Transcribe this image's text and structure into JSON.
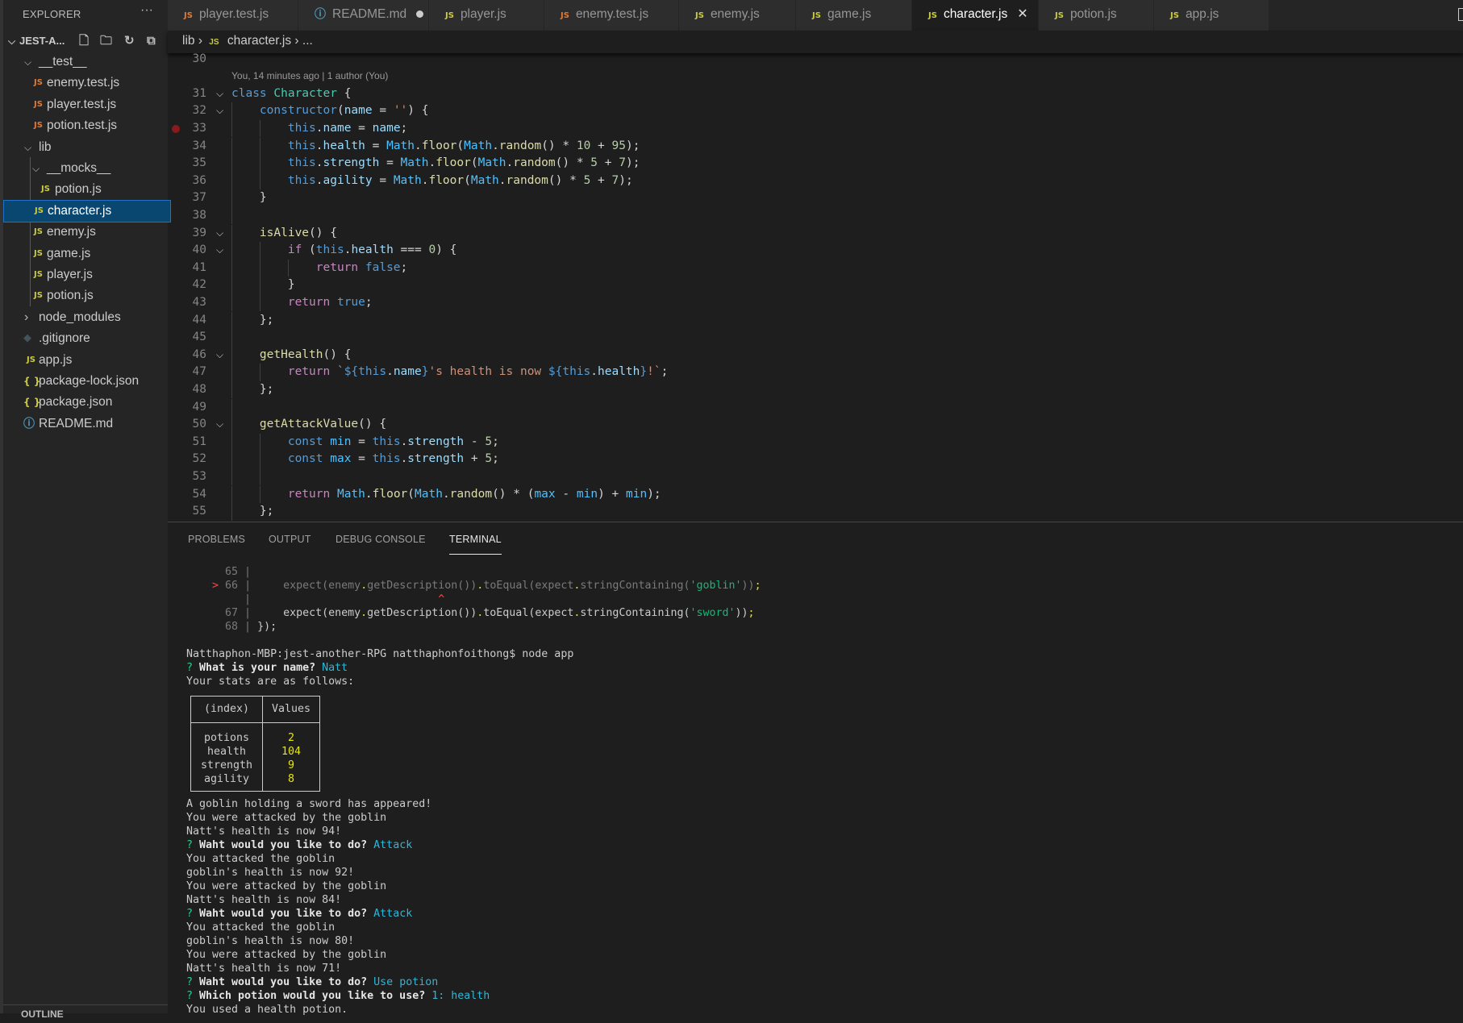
{
  "sidebar": {
    "title": "EXPLORER",
    "more": "···",
    "project": "JEST-A...",
    "outline": "OUTLINE",
    "items": [
      {
        "label": "__test__",
        "type": "folder",
        "open": true
      },
      {
        "label": "enemy.test.js",
        "type": "test"
      },
      {
        "label": "player.test.js",
        "type": "test"
      },
      {
        "label": "potion.test.js",
        "type": "test"
      },
      {
        "label": "lib",
        "type": "folder",
        "open": true
      },
      {
        "label": "__mocks__",
        "type": "folder",
        "open": true
      },
      {
        "label": "potion.js",
        "type": "js"
      },
      {
        "label": "character.js",
        "type": "js",
        "selected": true
      },
      {
        "label": "enemy.js",
        "type": "js"
      },
      {
        "label": "game.js",
        "type": "js"
      },
      {
        "label": "player.js",
        "type": "js"
      },
      {
        "label": "potion.js",
        "type": "js"
      },
      {
        "label": "node_modules",
        "type": "folder",
        "open": false
      },
      {
        "label": ".gitignore",
        "type": "git"
      },
      {
        "label": "app.js",
        "type": "js"
      },
      {
        "label": "package-lock.json",
        "type": "json"
      },
      {
        "label": "package.json",
        "type": "json"
      },
      {
        "label": "README.md",
        "type": "info"
      }
    ]
  },
  "tabs": [
    {
      "label": "player.test.js",
      "icon": "JS",
      "kind": "test"
    },
    {
      "label": "README.md",
      "icon": "ⓘ",
      "kind": "info",
      "dirty": true
    },
    {
      "label": "player.js",
      "icon": "JS",
      "kind": "js"
    },
    {
      "label": "enemy.test.js",
      "icon": "JS",
      "kind": "test"
    },
    {
      "label": "enemy.js",
      "icon": "JS",
      "kind": "js"
    },
    {
      "label": "game.js",
      "icon": "JS",
      "kind": "js"
    },
    {
      "label": "character.js",
      "icon": "JS",
      "kind": "js",
      "active": true
    },
    {
      "label": "potion.js",
      "icon": "JS",
      "kind": "js"
    },
    {
      "label": "app.js",
      "icon": "JS",
      "kind": "js"
    }
  ],
  "breadcrumb": {
    "folder": "lib",
    "icon": "JS",
    "file": "character.js",
    "more": "..."
  },
  "editor": {
    "codelens": "You, 14 minutes ago | 1 author (You)",
    "lines": [
      {
        "n": "30",
        "tokens": []
      },
      {
        "lens": true
      },
      {
        "n": "31",
        "fold": true,
        "tokens": [
          [
            "class",
            "k"
          ],
          [
            " ",
            ""
          ],
          [
            "Character",
            "t"
          ],
          [
            " {",
            ""
          ]
        ]
      },
      {
        "n": "32",
        "fold": true,
        "tokens": [
          [
            "    ",
            ""
          ],
          [
            "constructor",
            "k"
          ],
          [
            "(",
            ""
          ],
          [
            "name",
            "v"
          ],
          [
            " = ",
            ""
          ],
          [
            "''",
            "s"
          ],
          [
            ") {",
            ""
          ]
        ]
      },
      {
        "n": "33",
        "bp": true,
        "tokens": [
          [
            "        ",
            ""
          ],
          [
            "this",
            "k"
          ],
          [
            ".",
            ""
          ],
          [
            "name",
            "v"
          ],
          [
            " = ",
            ""
          ],
          [
            "name",
            "v"
          ],
          [
            ";",
            ""
          ]
        ]
      },
      {
        "n": "34",
        "tokens": [
          [
            "        ",
            ""
          ],
          [
            "this",
            "k"
          ],
          [
            ".",
            ""
          ],
          [
            "health",
            "v"
          ],
          [
            " = ",
            ""
          ],
          [
            "Math",
            "c2"
          ],
          [
            ".",
            ""
          ],
          [
            "floor",
            "f"
          ],
          [
            "(",
            ""
          ],
          [
            "Math",
            "c2"
          ],
          [
            ".",
            ""
          ],
          [
            "random",
            "f"
          ],
          [
            "() * ",
            ""
          ],
          [
            "10",
            "n"
          ],
          [
            " + ",
            ""
          ],
          [
            "95",
            "n"
          ],
          [
            ");",
            ""
          ]
        ]
      },
      {
        "n": "35",
        "tokens": [
          [
            "        ",
            ""
          ],
          [
            "this",
            "k"
          ],
          [
            ".",
            ""
          ],
          [
            "strength",
            "v"
          ],
          [
            " = ",
            ""
          ],
          [
            "Math",
            "c2"
          ],
          [
            ".",
            ""
          ],
          [
            "floor",
            "f"
          ],
          [
            "(",
            ""
          ],
          [
            "Math",
            "c2"
          ],
          [
            ".",
            ""
          ],
          [
            "random",
            "f"
          ],
          [
            "() * ",
            ""
          ],
          [
            "5",
            "n"
          ],
          [
            " + ",
            ""
          ],
          [
            "7",
            "n"
          ],
          [
            ");",
            ""
          ]
        ]
      },
      {
        "n": "36",
        "tokens": [
          [
            "        ",
            ""
          ],
          [
            "this",
            "k"
          ],
          [
            ".",
            ""
          ],
          [
            "agility",
            "v"
          ],
          [
            " = ",
            ""
          ],
          [
            "Math",
            "c2"
          ],
          [
            ".",
            ""
          ],
          [
            "floor",
            "f"
          ],
          [
            "(",
            ""
          ],
          [
            "Math",
            "c2"
          ],
          [
            ".",
            ""
          ],
          [
            "random",
            "f"
          ],
          [
            "() * ",
            ""
          ],
          [
            "5",
            "n"
          ],
          [
            " + ",
            ""
          ],
          [
            "7",
            "n"
          ],
          [
            ");",
            ""
          ]
        ]
      },
      {
        "n": "37",
        "tokens": [
          [
            "    }",
            ""
          ]
        ]
      },
      {
        "n": "38",
        "tokens": []
      },
      {
        "n": "39",
        "fold": true,
        "tokens": [
          [
            "    ",
            ""
          ],
          [
            "isAlive",
            "f"
          ],
          [
            "() {",
            ""
          ]
        ]
      },
      {
        "n": "40",
        "fold": true,
        "tokens": [
          [
            "        ",
            ""
          ],
          [
            "if",
            "c"
          ],
          [
            " (",
            ""
          ],
          [
            "this",
            "k"
          ],
          [
            ".",
            ""
          ],
          [
            "health",
            "v"
          ],
          [
            " === ",
            ""
          ],
          [
            "0",
            "n"
          ],
          [
            ") {",
            ""
          ]
        ]
      },
      {
        "n": "41",
        "tokens": [
          [
            "            ",
            ""
          ],
          [
            "return",
            "c"
          ],
          [
            " ",
            ""
          ],
          [
            "false",
            "k"
          ],
          [
            ";",
            ""
          ]
        ]
      },
      {
        "n": "42",
        "tokens": [
          [
            "        }",
            ""
          ]
        ]
      },
      {
        "n": "43",
        "tokens": [
          [
            "        ",
            ""
          ],
          [
            "return",
            "c"
          ],
          [
            " ",
            ""
          ],
          [
            "true",
            "k"
          ],
          [
            ";",
            ""
          ]
        ]
      },
      {
        "n": "44",
        "tokens": [
          [
            "    };",
            ""
          ]
        ]
      },
      {
        "n": "45",
        "tokens": []
      },
      {
        "n": "46",
        "fold": true,
        "tokens": [
          [
            "    ",
            ""
          ],
          [
            "getHealth",
            "f"
          ],
          [
            "() {",
            ""
          ]
        ]
      },
      {
        "n": "47",
        "tokens": [
          [
            "        ",
            ""
          ],
          [
            "return",
            "c"
          ],
          [
            " ",
            ""
          ],
          [
            "`",
            "s"
          ],
          [
            "${",
            "k"
          ],
          [
            "this",
            "k"
          ],
          [
            ".",
            ""
          ],
          [
            "name",
            "v"
          ],
          [
            "}",
            "k"
          ],
          [
            "'s health is now ",
            "s"
          ],
          [
            "${",
            "k"
          ],
          [
            "this",
            "k"
          ],
          [
            ".",
            ""
          ],
          [
            "health",
            "v"
          ],
          [
            "}",
            "k"
          ],
          [
            "!`",
            "s"
          ],
          [
            ";",
            ""
          ]
        ]
      },
      {
        "n": "48",
        "tokens": [
          [
            "    };",
            ""
          ]
        ]
      },
      {
        "n": "49",
        "tokens": []
      },
      {
        "n": "50",
        "fold": true,
        "tokens": [
          [
            "    ",
            ""
          ],
          [
            "getAttackValue",
            "f"
          ],
          [
            "() {",
            ""
          ]
        ]
      },
      {
        "n": "51",
        "tokens": [
          [
            "        ",
            ""
          ],
          [
            "const",
            "k"
          ],
          [
            " ",
            ""
          ],
          [
            "min",
            "c2"
          ],
          [
            " = ",
            ""
          ],
          [
            "this",
            "k"
          ],
          [
            ".",
            ""
          ],
          [
            "strength",
            "v"
          ],
          [
            " - ",
            ""
          ],
          [
            "5",
            "n"
          ],
          [
            ";",
            ""
          ]
        ]
      },
      {
        "n": "52",
        "tokens": [
          [
            "        ",
            ""
          ],
          [
            "const",
            "k"
          ],
          [
            " ",
            ""
          ],
          [
            "max",
            "c2"
          ],
          [
            " = ",
            ""
          ],
          [
            "this",
            "k"
          ],
          [
            ".",
            ""
          ],
          [
            "strength",
            "v"
          ],
          [
            " + ",
            ""
          ],
          [
            "5",
            "n"
          ],
          [
            ";",
            ""
          ]
        ]
      },
      {
        "n": "53",
        "tokens": []
      },
      {
        "n": "54",
        "tokens": [
          [
            "        ",
            ""
          ],
          [
            "return",
            "c"
          ],
          [
            " ",
            ""
          ],
          [
            "Math",
            "c2"
          ],
          [
            ".",
            ""
          ],
          [
            "floor",
            "f"
          ],
          [
            "(",
            ""
          ],
          [
            "Math",
            "c2"
          ],
          [
            ".",
            ""
          ],
          [
            "random",
            "f"
          ],
          [
            "() * (",
            ""
          ],
          [
            "max",
            "c2"
          ],
          [
            " - ",
            ""
          ],
          [
            "min",
            "c2"
          ],
          [
            ") + ",
            ""
          ],
          [
            "min",
            "c2"
          ],
          [
            ");",
            ""
          ]
        ]
      },
      {
        "n": "55",
        "tokens": [
          [
            "    };",
            ""
          ]
        ]
      }
    ]
  },
  "panel": {
    "tabs": [
      "PROBLEMS",
      "OUTPUT",
      "DEBUG CONSOLE",
      "TERMINAL"
    ],
    "active": "TERMINAL"
  },
  "terminal": {
    "before": [
      [
        [
          "      65 | ",
          "dim"
        ]
      ],
      [
        [
          "    ",
          ""
        ],
        [
          "> ",
          "r"
        ],
        [
          "66",
          "dim"
        ],
        [
          " |     ",
          "dim"
        ],
        [
          "expect(enemy",
          "dim"
        ],
        [
          ".",
          "y"
        ],
        [
          "getDescription())",
          "dim"
        ],
        [
          ".",
          "y"
        ],
        [
          "toEqual(expect",
          "dim"
        ],
        [
          ".",
          "y"
        ],
        [
          "stringContaining(",
          "dim"
        ],
        [
          "'goblin'",
          "g"
        ],
        [
          "))",
          "dim"
        ],
        [
          ";",
          "y"
        ]
      ],
      [
        [
          "         | ",
          "dim"
        ],
        [
          "                            ",
          ""
        ],
        [
          "^",
          "r"
        ]
      ],
      [
        [
          "      67 | ",
          "dim"
        ],
        [
          "    expect(enemy",
          ""
        ],
        [
          ".",
          "y"
        ],
        [
          "getDescription())",
          ""
        ],
        [
          ".",
          "y"
        ],
        [
          "toEqual(expect",
          ""
        ],
        [
          ".",
          "y"
        ],
        [
          "stringContaining(",
          ""
        ],
        [
          "'sword'",
          "g"
        ],
        [
          "))",
          ""
        ],
        [
          ";",
          "y"
        ]
      ],
      [
        [
          "      68 | ",
          "dim"
        ],
        [
          "});",
          ""
        ]
      ],
      [],
      [
        [
          "Natthaphon-MBP:jest-another-RPG natthaphonfoithong$ node app",
          ""
        ]
      ],
      [
        [
          "? ",
          "q"
        ],
        [
          "What is your name? ",
          "b"
        ],
        [
          "Natt",
          "cy"
        ]
      ],
      [
        [
          "Your stats are as follows:",
          ""
        ]
      ]
    ],
    "table": {
      "headers": [
        "(index)",
        "Values"
      ],
      "rows": [
        [
          "potions",
          "2"
        ],
        [
          "health",
          "104"
        ],
        [
          "strength",
          "9"
        ],
        [
          "agility",
          "8"
        ]
      ]
    },
    "after": [
      [
        [
          "A goblin holding a sword has appeared!",
          ""
        ]
      ],
      [
        [
          "You were attacked by the goblin",
          ""
        ]
      ],
      [
        [
          "Natt's health is now 94!",
          ""
        ]
      ],
      [
        [
          "? ",
          "q"
        ],
        [
          "Waht would you like to do? ",
          "b"
        ],
        [
          "Attack",
          "cy"
        ]
      ],
      [
        [
          "You attacked the goblin",
          ""
        ]
      ],
      [
        [
          "goblin's health is now 92!",
          ""
        ]
      ],
      [
        [
          "You were attacked by the goblin",
          ""
        ]
      ],
      [
        [
          "Natt's health is now 84!",
          ""
        ]
      ],
      [
        [
          "? ",
          "q"
        ],
        [
          "Waht would you like to do? ",
          "b"
        ],
        [
          "Attack",
          "cy"
        ]
      ],
      [
        [
          "You attacked the goblin",
          ""
        ]
      ],
      [
        [
          "goblin's health is now 80!",
          ""
        ]
      ],
      [
        [
          "You were attacked by the goblin",
          ""
        ]
      ],
      [
        [
          "Natt's health is now 71!",
          ""
        ]
      ],
      [
        [
          "? ",
          "q"
        ],
        [
          "Waht would you like to do? ",
          "b"
        ],
        [
          "Use potion",
          "cy"
        ]
      ],
      [
        [
          "? ",
          "q"
        ],
        [
          "Which potion would you like to use? ",
          "b"
        ],
        [
          "1: health",
          "cy"
        ]
      ],
      [
        [
          "You used a health potion.",
          ""
        ]
      ]
    ]
  }
}
